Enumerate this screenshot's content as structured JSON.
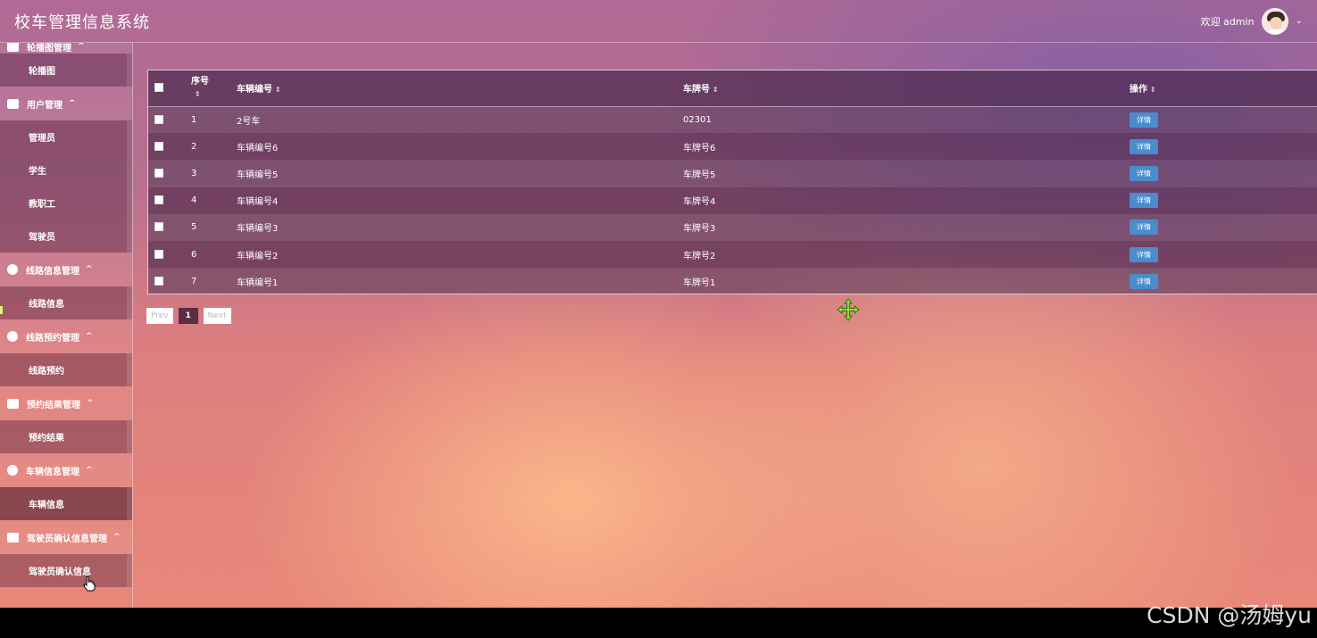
{
  "header": {
    "title": "校车管理信息系统",
    "welcome": "欢迎 admin"
  },
  "sidebar": {
    "groups": [
      {
        "label": "轮播图管理",
        "icon": "image-icon",
        "items": [
          "轮播图"
        ]
      },
      {
        "label": "用户管理",
        "icon": "user-group-icon",
        "items": [
          "管理员",
          "学生",
          "教职工",
          "驾驶员"
        ]
      },
      {
        "label": "线路信息管理",
        "icon": "compass-icon",
        "items": [
          "线路信息"
        ]
      },
      {
        "label": "线路预约管理",
        "icon": "target-icon",
        "items": [
          "线路预约"
        ]
      },
      {
        "label": "预约结果管理",
        "icon": "layout-icon",
        "items": [
          "预约结果"
        ]
      },
      {
        "label": "车辆信息管理",
        "icon": "compass-icon",
        "items": [
          "车辆信息"
        ]
      },
      {
        "label": "驾驶员确认信息管理",
        "icon": "wallet-icon",
        "items": [
          "驾驶员确认信息"
        ]
      }
    ]
  },
  "table": {
    "columns": [
      "序号",
      "车辆编号",
      "车牌号",
      "操作"
    ],
    "detail_label": "详情",
    "rows": [
      {
        "index": "1",
        "vehicle_no": "2号车",
        "plate": "02301"
      },
      {
        "index": "2",
        "vehicle_no": "车辆编号6",
        "plate": "车牌号6"
      },
      {
        "index": "3",
        "vehicle_no": "车辆编号5",
        "plate": "车牌号5"
      },
      {
        "index": "4",
        "vehicle_no": "车辆编号4",
        "plate": "车牌号4"
      },
      {
        "index": "5",
        "vehicle_no": "车辆编号3",
        "plate": "车牌号3"
      },
      {
        "index": "6",
        "vehicle_no": "车辆编号2",
        "plate": "车牌号2"
      },
      {
        "index": "7",
        "vehicle_no": "车辆编号1",
        "plate": "车牌号1"
      }
    ]
  },
  "pagination": {
    "prev": "Prev",
    "current": "1",
    "next": "Next"
  },
  "watermark": "CSDN @汤姆yu",
  "colors": {
    "detail_button": "#4a8ccc",
    "active_page": "#5a2d45"
  }
}
